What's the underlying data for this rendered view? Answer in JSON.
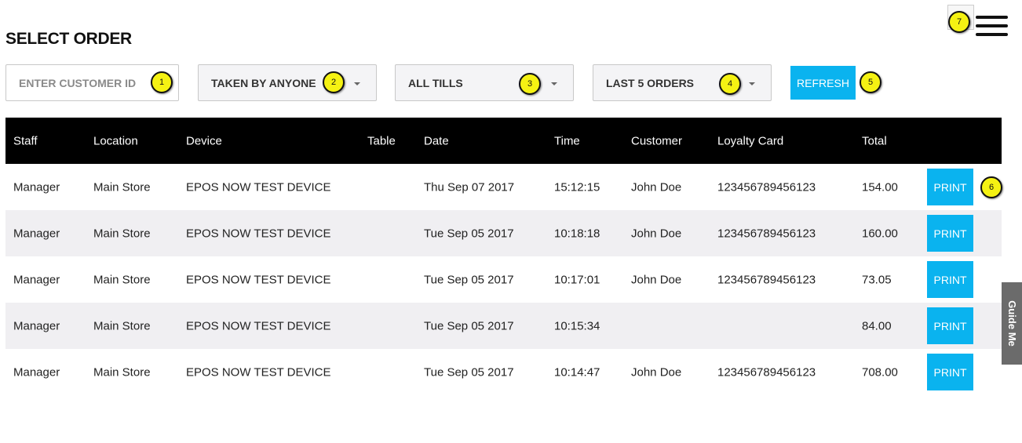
{
  "page": {
    "title": "SELECT ORDER"
  },
  "filters": {
    "customer_placeholder": "ENTER CUSTOMER ID",
    "taken_by": "TAKEN BY ANYONE",
    "tills": "ALL TILLS",
    "orders": "LAST 5 ORDERS",
    "refresh_label": "REFRESH"
  },
  "badges": [
    "1",
    "2",
    "3",
    "4",
    "5",
    "6",
    "7"
  ],
  "table": {
    "headers": [
      "Staff",
      "Location",
      "Device",
      "Table",
      "Date",
      "Time",
      "Customer",
      "Loyalty Card",
      "Total"
    ],
    "print_label": "PRINT",
    "rows": [
      {
        "staff": "Manager",
        "location": "Main Store",
        "device": "EPOS NOW TEST DEVICE",
        "table": "",
        "date": "Thu Sep 07 2017",
        "time": "15:12:15",
        "customer": "John Doe",
        "loyalty": "123456789456123",
        "total": "154.00"
      },
      {
        "staff": "Manager",
        "location": "Main Store",
        "device": "EPOS NOW TEST DEVICE",
        "table": "",
        "date": "Tue Sep 05 2017",
        "time": "10:18:18",
        "customer": "John Doe",
        "loyalty": "123456789456123",
        "total": "160.00"
      },
      {
        "staff": "Manager",
        "location": "Main Store",
        "device": "EPOS NOW TEST DEVICE",
        "table": "",
        "date": "Tue Sep 05 2017",
        "time": "10:17:01",
        "customer": "John Doe",
        "loyalty": "123456789456123",
        "total": "73.05"
      },
      {
        "staff": "Manager",
        "location": "Main Store",
        "device": "EPOS NOW TEST DEVICE",
        "table": "",
        "date": "Tue Sep 05 2017",
        "time": "10:15:34",
        "customer": "",
        "loyalty": "",
        "total": "84.00"
      },
      {
        "staff": "Manager",
        "location": "Main Store",
        "device": "EPOS NOW TEST DEVICE",
        "table": "",
        "date": "Tue Sep 05 2017",
        "time": "10:14:47",
        "customer": "John Doe",
        "loyalty": "123456789456123",
        "total": "708.00"
      }
    ]
  },
  "guide": {
    "label": "Guide Me"
  },
  "icons": {
    "menu": "hamburger-menu-icon",
    "dropdown": "chevron-down-icon"
  },
  "colors": {
    "accent": "#0ab3ef",
    "header_bg": "#000000",
    "badge": "#f5f213",
    "guide_bg": "#6b6b6b"
  }
}
